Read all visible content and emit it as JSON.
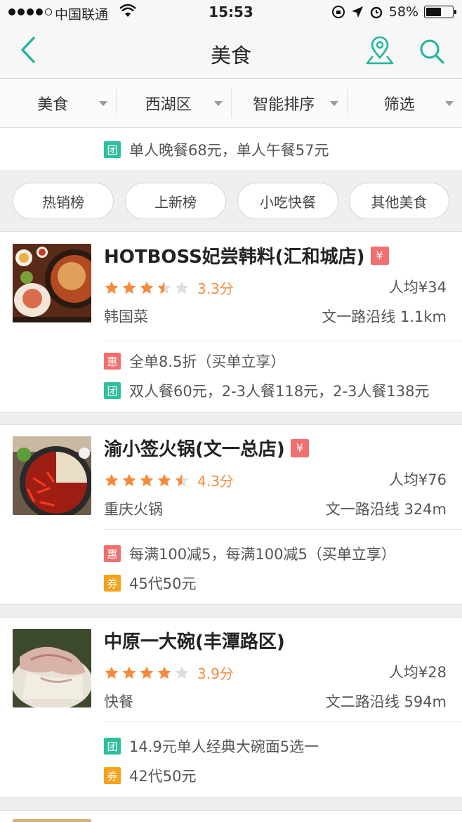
{
  "status_bar": {
    "carrier": "中国联通",
    "time": "15:53",
    "battery": "58%",
    "battery_level": 0.58
  },
  "nav": {
    "title": "美食",
    "icons": [
      "back-chevron-icon",
      "location-pin-icon",
      "search-icon"
    ],
    "accent_color": "#1fb59a"
  },
  "filters": [
    {
      "label": "美食"
    },
    {
      "label": "西湖区"
    },
    {
      "label": "智能排序"
    },
    {
      "label": "筛选"
    }
  ],
  "top_deal": {
    "badge": "团",
    "text": "单人晚餐68元，单人午餐57元"
  },
  "pills": [
    {
      "label": "热销榜"
    },
    {
      "label": "上新榜"
    },
    {
      "label": "小吃快餐"
    },
    {
      "label": "其他美食"
    }
  ],
  "restaurants": [
    {
      "name": "HOTBOSS妃尝韩料(汇和城店)",
      "pay_badge": "¥",
      "rating": 3.5,
      "score": "3.3分",
      "avg_price": "人均¥34",
      "category": "韩国菜",
      "distance": "文一路沿线  1.1km",
      "deals": [
        {
          "badge": "惠",
          "type": "hui",
          "text": "全单8.5折（买单立享）"
        },
        {
          "badge": "团",
          "type": "tuan",
          "text": "双人餐60元，2-3人餐118元，2-3人餐138元"
        }
      ]
    },
    {
      "name": "渝小签火锅(文一总店)",
      "pay_badge": "¥",
      "rating": 4.5,
      "score": "4.3分",
      "avg_price": "人均¥76",
      "category": "重庆火锅",
      "distance": "文一路沿线  324m",
      "deals": [
        {
          "badge": "惠",
          "type": "hui",
          "text": "每满100减5，每满100减5（买单立享）"
        },
        {
          "badge": "券",
          "type": "quan",
          "text": "45代50元"
        }
      ]
    },
    {
      "name": "中原一大碗(丰潭路区)",
      "pay_badge": "",
      "rating": 4,
      "score": "3.9分",
      "avg_price": "人均¥28",
      "category": "快餐",
      "distance": "文二路沿线  594m",
      "deals": [
        {
          "badge": "团",
          "type": "tuan",
          "text": "14.9元单人经典大碗面5选一"
        },
        {
          "badge": "券",
          "type": "quan",
          "text": "42代50元"
        }
      ]
    }
  ],
  "colors": {
    "accent": "#1fb59a",
    "star": "#f7893b",
    "star_empty": "#dddddd",
    "tuan": "#2ebf9f",
    "hui": "#f07070",
    "quan": "#f6a21b"
  }
}
